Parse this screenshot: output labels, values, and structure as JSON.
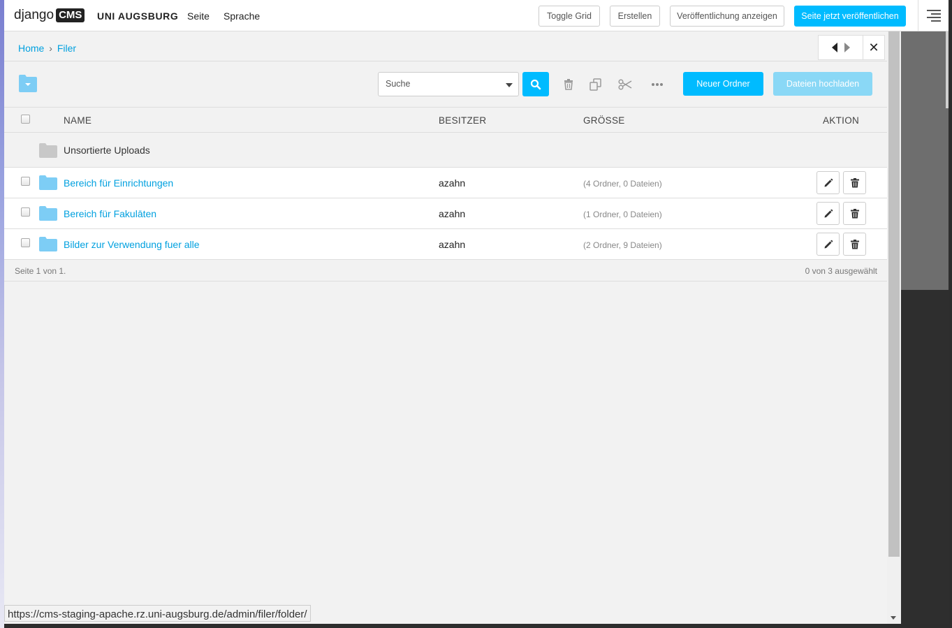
{
  "toolbar": {
    "logo_text": "django",
    "logo_badge": "CMS",
    "site_name": "UNI AUGSBURG",
    "menu": [
      "Seite",
      "Sprache"
    ],
    "buttons": {
      "toggle_grid": "Toggle Grid",
      "create": "Erstellen",
      "view_published": "Veröffentlichung anzeigen",
      "publish_now": "Seite jetzt veröffentlichen"
    },
    "menu_icon": "hamburger-icon"
  },
  "breadcrumb": {
    "home": "Home",
    "separator": "›",
    "current": "Filer"
  },
  "frame_controls": {
    "back_icon": "arrow-left-icon",
    "forward_icon": "arrow-right-icon",
    "close_icon": "close-icon",
    "close_glyph": "✕"
  },
  "actions": {
    "search_placeholder": "Suche",
    "new_folder": "Neuer Ordner",
    "upload_files": "Dateien hochladen"
  },
  "table": {
    "headers": {
      "name": "NAME",
      "owner": "BESITZER",
      "size": "GRÖSSE",
      "action": "AKTION"
    },
    "unsorted": {
      "name": "Unsortierte Uploads"
    },
    "rows": [
      {
        "name": "Bereich für Einrichtungen",
        "owner": "azahn",
        "size": "(4 Ordner, 0 Dateien)"
      },
      {
        "name": "Bereich für Fakulāten",
        "owner": "azahn",
        "size": "(1 Ordner, 0 Dateien)"
      },
      {
        "name": "Bilder zur Verwendung fuer alle",
        "owner": "azahn",
        "size": "(2 Ordner, 9 Dateien)"
      }
    ],
    "footer": {
      "pagination": "Seite 1 von 1.",
      "selection": "0 von 3 ausgewählt"
    }
  },
  "status_url": "https://cms-staging-apache.rz.uni-augsburg.de/admin/filer/folder/",
  "colors": {
    "accent": "#00bbff",
    "link": "#00a0df",
    "folder": "#7dcdf5",
    "folder_unsorted": "#c8c8c8",
    "upload_disabled": "#8ad8f6"
  }
}
